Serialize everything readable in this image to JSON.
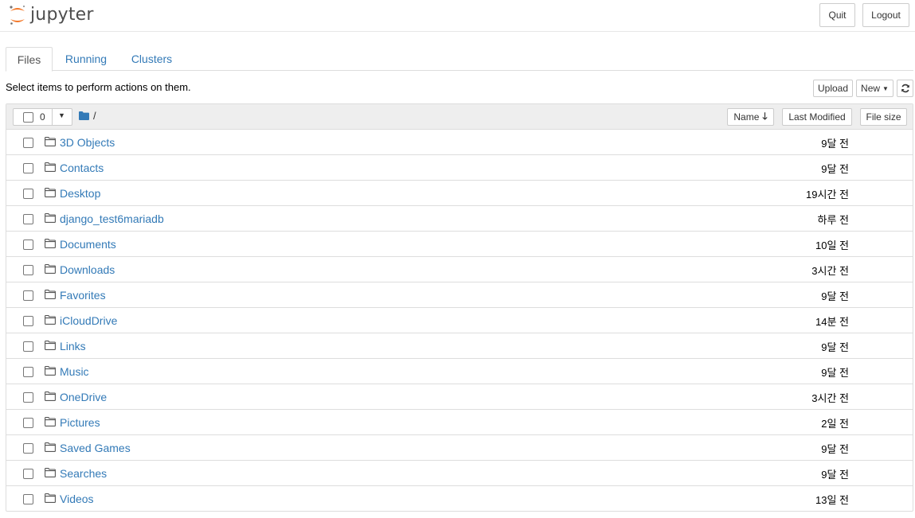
{
  "header": {
    "logo_text": "jupyter",
    "quit_label": "Quit",
    "logout_label": "Logout"
  },
  "tabs": [
    {
      "label": "Files",
      "active": true
    },
    {
      "label": "Running",
      "active": false
    },
    {
      "label": "Clusters",
      "active": false
    }
  ],
  "toolbar": {
    "hint": "Select items to perform actions on them.",
    "upload_label": "Upload",
    "new_label": "New"
  },
  "list_header": {
    "selected_count": "0",
    "path": "/",
    "sort_name_label": "Name",
    "sort_modified_label": "Last Modified",
    "sort_size_label": "File size"
  },
  "items": [
    {
      "name": "3D Objects",
      "modified": "9달 전"
    },
    {
      "name": "Contacts",
      "modified": "9달 전"
    },
    {
      "name": "Desktop",
      "modified": "19시간 전"
    },
    {
      "name": "django_test6mariadb",
      "modified": "하루 전"
    },
    {
      "name": "Documents",
      "modified": "10일 전"
    },
    {
      "name": "Downloads",
      "modified": "3시간 전"
    },
    {
      "name": "Favorites",
      "modified": "9달 전"
    },
    {
      "name": "iCloudDrive",
      "modified": "14분 전"
    },
    {
      "name": "Links",
      "modified": "9달 전"
    },
    {
      "name": "Music",
      "modified": "9달 전"
    },
    {
      "name": "OneDrive",
      "modified": "3시간 전"
    },
    {
      "name": "Pictures",
      "modified": "2일 전"
    },
    {
      "name": "Saved Games",
      "modified": "9달 전"
    },
    {
      "name": "Searches",
      "modified": "9달 전"
    },
    {
      "name": "Videos",
      "modified": "13일 전"
    }
  ],
  "colors": {
    "link": "#337ab7",
    "logo_orange": "#f37626",
    "header_bg": "#eeeeee",
    "border": "#dddddd"
  }
}
